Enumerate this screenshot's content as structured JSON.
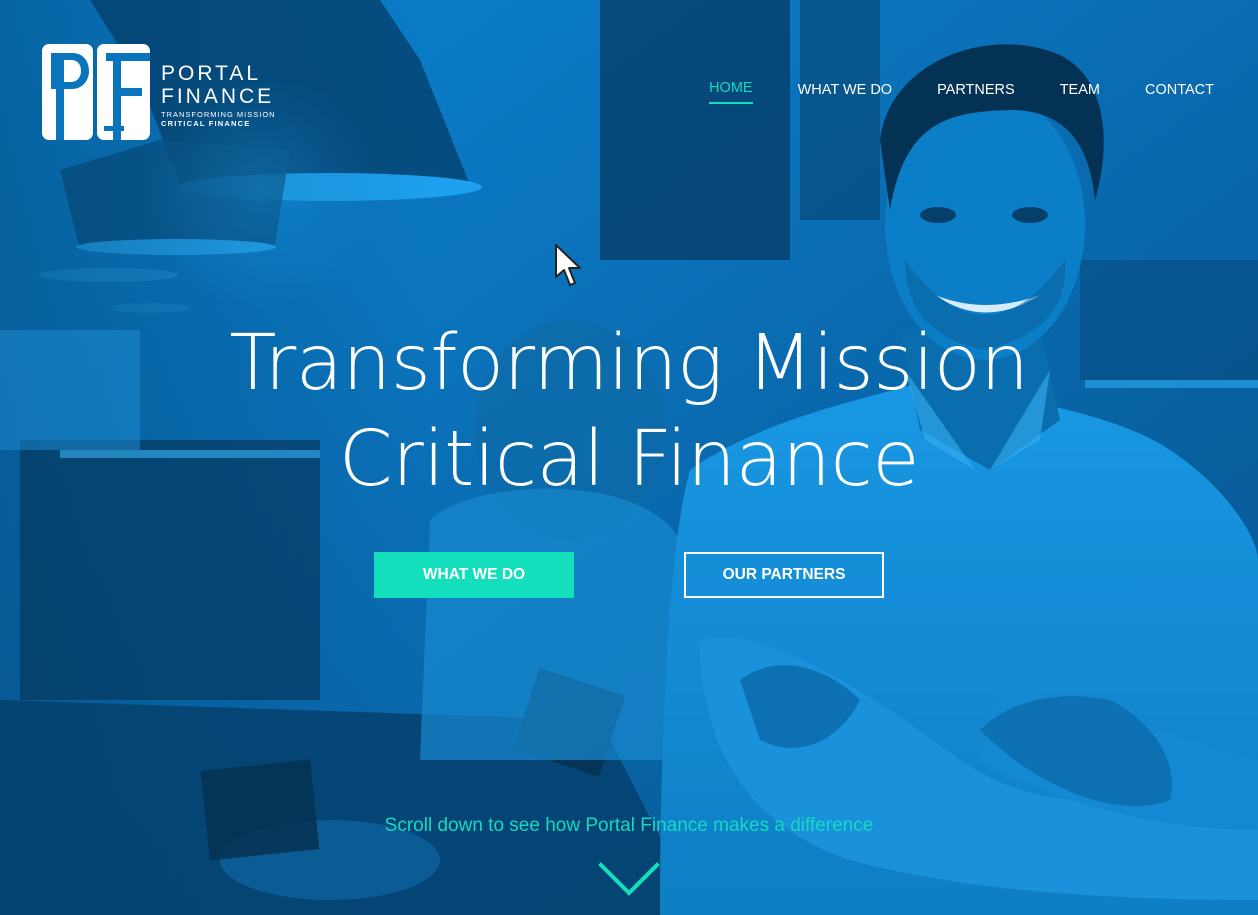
{
  "brand": {
    "name_line1": "PORTAL",
    "name_line2": "FINANCE",
    "tagline_line1": "TRANSFORMING MISSION",
    "tagline_line2": "CRITICAL FINANCE"
  },
  "nav": {
    "items": [
      {
        "label": "HOME",
        "active": true
      },
      {
        "label": "WHAT WE DO",
        "active": false
      },
      {
        "label": "PARTNERS",
        "active": false
      },
      {
        "label": "TEAM",
        "active": false
      },
      {
        "label": "CONTACT",
        "active": false
      }
    ]
  },
  "hero": {
    "headline_line1": "Transforming Mission",
    "headline_line2": "Critical Finance",
    "primary_button": "WHAT WE DO",
    "secondary_button": "OUR PARTNERS",
    "scroll_text": "Scroll down to see how Portal Finance makes a difference"
  },
  "colors": {
    "accent": "#14dfbd",
    "overlay": "#0a7fc8",
    "text": "#ffffff"
  },
  "icons": {
    "logo": "pf-monogram",
    "scroll": "chevron-down-icon",
    "cursor": "mouse-pointer"
  }
}
